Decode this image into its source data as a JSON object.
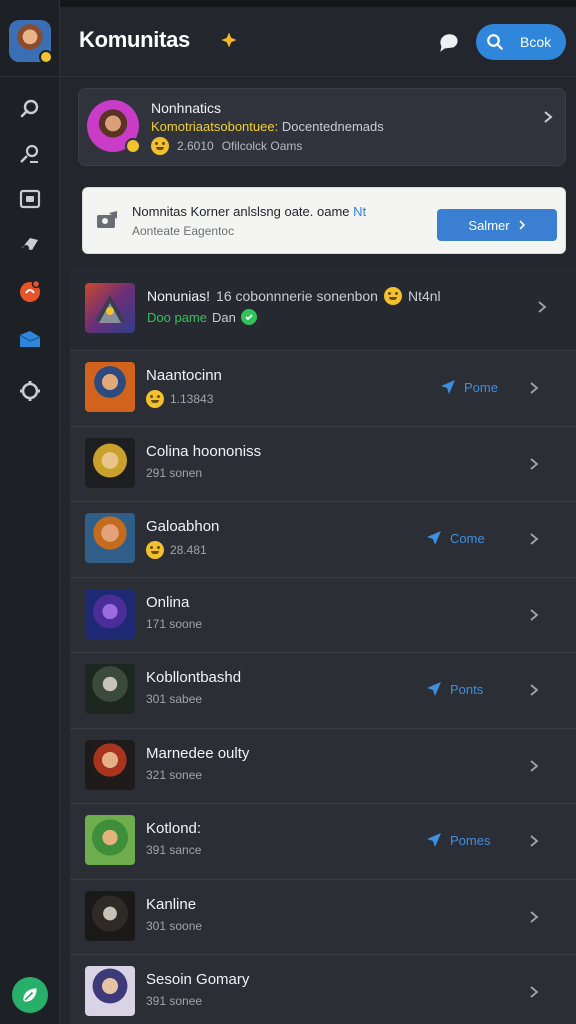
{
  "app": {
    "title": "Komunitas",
    "search_label": "Bcok"
  },
  "colors": {
    "accent": "#2f86da",
    "online": "#32c25c",
    "highlight": "#f0d02c",
    "background": "#23262d"
  },
  "sidebar": {
    "items": [
      {
        "icon": "search-icon"
      },
      {
        "icon": "people-search-icon"
      },
      {
        "icon": "camera-icon"
      },
      {
        "icon": "gamepad-icon"
      },
      {
        "icon": "notification-icon"
      },
      {
        "icon": "mail-icon"
      },
      {
        "icon": "settings-icon"
      }
    ],
    "bottom_icon": "leaf-icon"
  },
  "profile": {
    "name": "Nonhnatics",
    "subtitle_highlight": "Komotriaatsobontuee:",
    "subtitle_rest": "Docentednemads",
    "count": "2.6010",
    "meta": "Ofilcolck Oams"
  },
  "banner": {
    "title": "Nomnitas Korner anlslsng oate. oame",
    "title_link": "Nt",
    "subtitle": "Aonteate Eagentoc",
    "button_label": "Salmer"
  },
  "featured": {
    "name": "Nonunias!",
    "extra": "16 cobonnnerie sonenbon",
    "extra2": "Nt4nl",
    "status_online": "Doo pame",
    "status_rest": "Dan"
  },
  "games": [
    {
      "name": "Naantocinn",
      "sub": "1.13843",
      "emoji": true,
      "action": "Pome"
    },
    {
      "name": "Colina hoononiss",
      "sub": "291 sonen",
      "emoji": false,
      "action": ""
    },
    {
      "name": "Galoabhon",
      "sub": "28.481",
      "emoji": true,
      "action": "Come"
    },
    {
      "name": "Onlina",
      "sub": "171 soone",
      "emoji": false,
      "action": ""
    },
    {
      "name": "Kobllontbashd",
      "sub": "301 sabee",
      "emoji": false,
      "action": "Ponts"
    },
    {
      "name": "Marnedee oulty",
      "sub": "321 sonee",
      "emoji": false,
      "action": ""
    },
    {
      "name": "Kotlond:",
      "sub": "391 sance",
      "emoji": false,
      "action": "Pomes"
    },
    {
      "name": "Kanline",
      "sub": "301 soone",
      "emoji": false,
      "action": ""
    },
    {
      "name": "Sesoin Gomary",
      "sub": "391 sonee",
      "emoji": false,
      "action": ""
    }
  ]
}
